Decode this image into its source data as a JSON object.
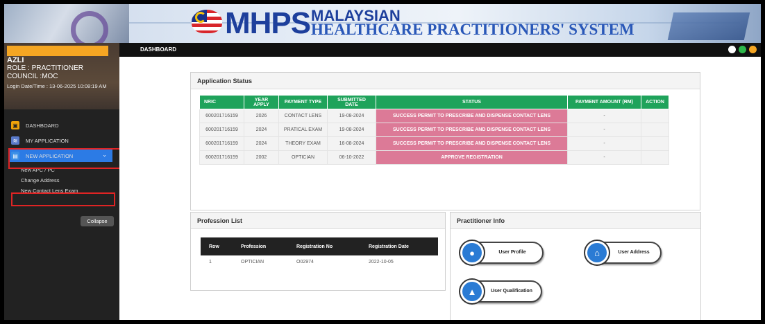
{
  "banner": {
    "logo": "MHPS",
    "title_line1": "MALAYSIAN",
    "title_line2": "HEALTHCARE PRACTITIONERS' SYSTEM"
  },
  "user": {
    "name": "AZLI",
    "role": "ROLE : PRACTITIONER",
    "council": "COUNCIL :MOC",
    "login": "Login Date/Time : 13-06-2025 10:08:19 AM"
  },
  "nav": {
    "dashboard": "DASHBOARD",
    "my_application": "MY APPLICATION",
    "new_application": "NEW APPLICATION",
    "sub": [
      "New APC / PC",
      "Change Address",
      "New Contact Lens Exam"
    ],
    "collapse": "Collapse"
  },
  "topbar": {
    "title": "DASHBOARD"
  },
  "application_status": {
    "title": "Application Status",
    "columns": [
      "NRIC",
      "YEAR APPLY",
      "PAYMENT TYPE",
      "SUBMITTED DATE",
      "STATUS",
      "PAYMENT AMOUNT (RM)",
      "ACTION"
    ],
    "rows": [
      [
        "600201716159",
        "2026",
        "CONTACT LENS",
        "19-08-2024",
        "SUCCESS PERMIT TO PRESCRIBE AND DISPENSE CONTACT LENS",
        "-",
        ""
      ],
      [
        "600201716159",
        "2024",
        "PRATICAL EXAM",
        "19-08-2024",
        "SUCCESS PERMIT TO PRESCRIBE AND DISPENSE CONTACT LENS",
        "-",
        ""
      ],
      [
        "600201716159",
        "2024",
        "THEORY EXAM",
        "16-08-2024",
        "SUCCESS PERMIT TO PRESCRIBE AND DISPENSE CONTACT LENS",
        "-",
        ""
      ],
      [
        "600201716159",
        "2002",
        "OPTICIAN",
        "06-10-2022",
        "APPROVE REGISTRATION",
        "-",
        ""
      ]
    ]
  },
  "profession_list": {
    "title": "Profession List",
    "columns": [
      "Row",
      "Profession",
      "Registration No",
      "Registration Date"
    ],
    "rows": [
      [
        "1",
        "OPTICIAN",
        "O02974",
        "2022-10-05"
      ]
    ]
  },
  "practitioner_info": {
    "title": "Practitioner Info",
    "buttons": {
      "profile": "User Profile",
      "address": "User Address",
      "qualification": "User Qualification"
    },
    "icons": {
      "profile": "user-icon",
      "address": "home-icon",
      "qualification": "graduation-cap-icon"
    }
  },
  "colors": {
    "status_header": "#1fa35b",
    "status_cell": "#dc7a97",
    "accent": "#2c7be5",
    "highlight": "#e02424"
  }
}
